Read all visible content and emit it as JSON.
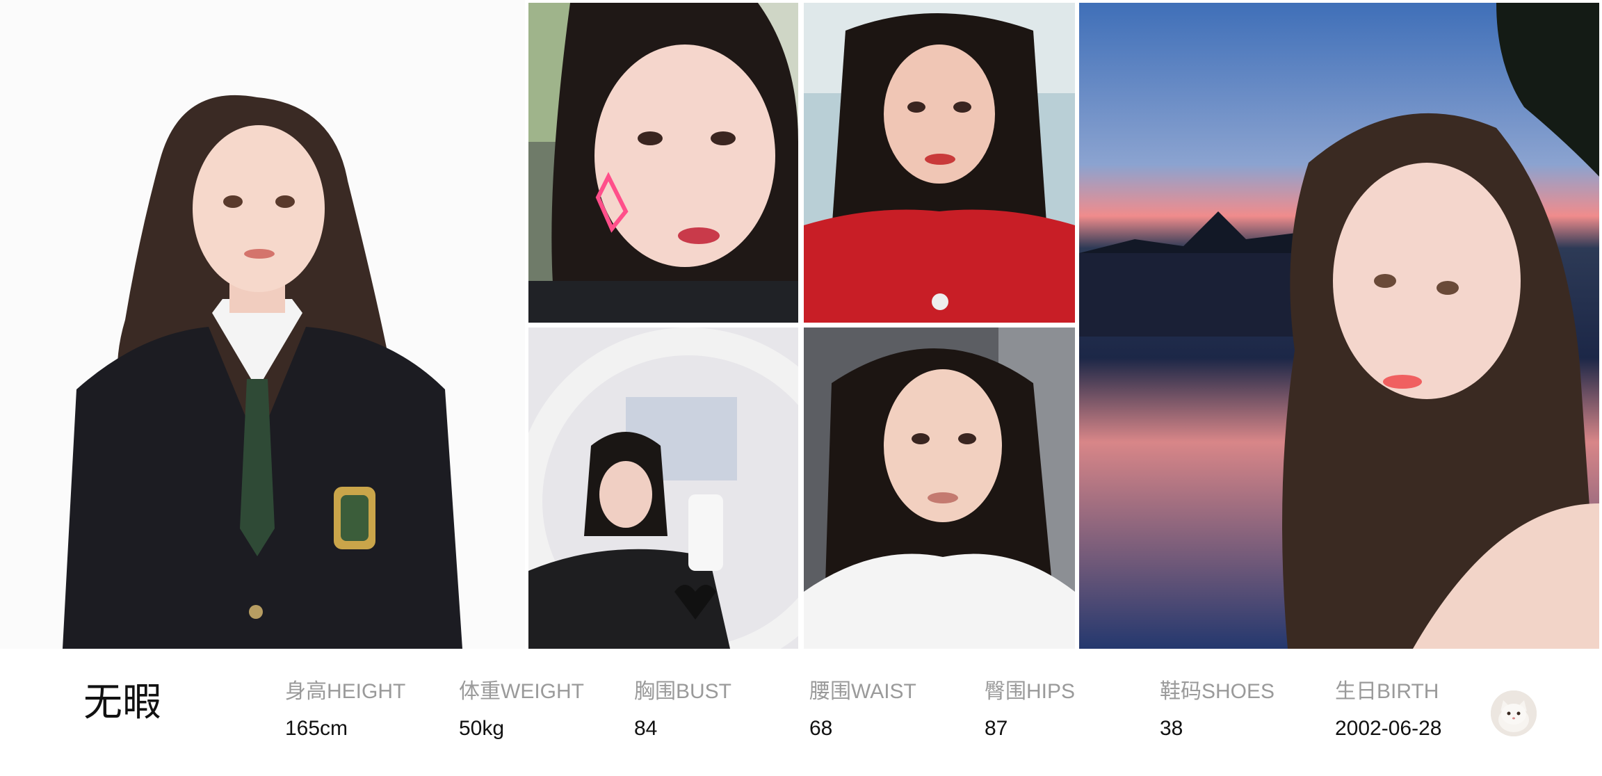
{
  "profile": {
    "name": "无暇"
  },
  "stats": [
    {
      "label": "身高HEIGHT",
      "value": "165cm"
    },
    {
      "label": "体重WEIGHT",
      "value": "50kg"
    },
    {
      "label": "胸围BUST",
      "value": "84"
    },
    {
      "label": "腰围WAIST",
      "value": "68"
    },
    {
      "label": "臀围HIPS",
      "value": "87"
    },
    {
      "label": "鞋码SHOES",
      "value": "38"
    },
    {
      "label": "生日BIRTH",
      "value": "2002-06-28"
    }
  ],
  "photos": {
    "main": {
      "icon": "portrait-uniform-photo"
    },
    "top_left": {
      "icon": "selfie-photo"
    },
    "top_right": {
      "icon": "selfie-red-sweater-photo"
    },
    "bottom_left": {
      "icon": "mirror-selfie-photo"
    },
    "bottom_right": {
      "icon": "selfie-white-top-photo"
    },
    "big": {
      "icon": "sunset-portrait-photo"
    }
  },
  "avatar": {
    "icon": "cat-avatar-icon"
  },
  "colors": {
    "label": "#9a9a9a",
    "value": "#111111",
    "background": "#ffffff"
  }
}
